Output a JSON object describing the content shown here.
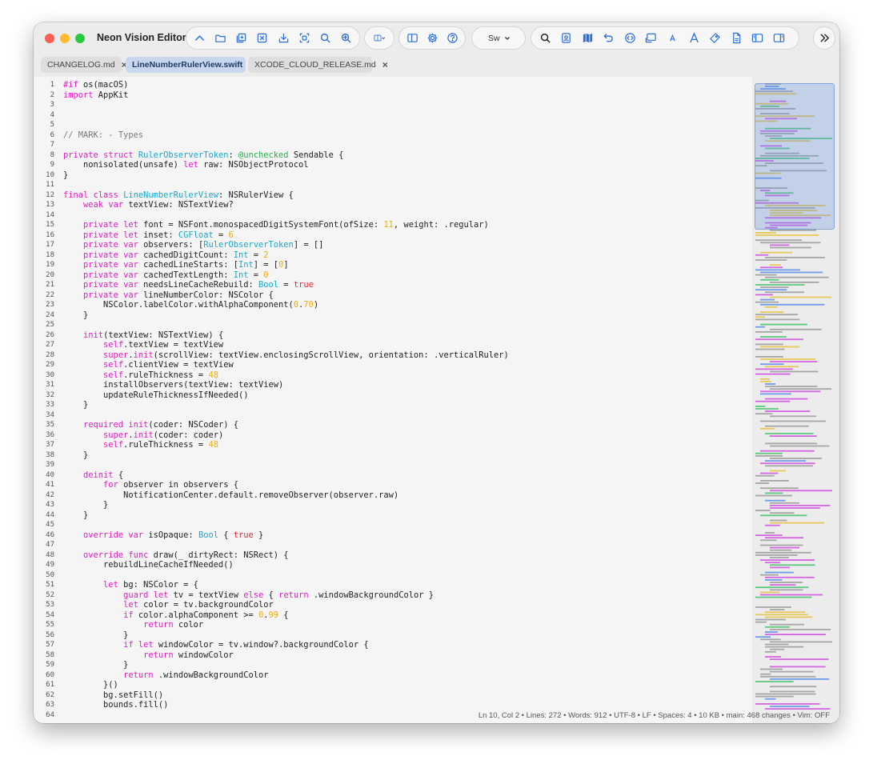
{
  "app": {
    "title": "Neon Vision Editor"
  },
  "toolbar": {
    "group_left": [
      "arrow-up-icon",
      "folder-icon",
      "new-document-icon",
      "close-file-icon",
      "download-icon",
      "scan-icon",
      "search-icon",
      "zoom-in-icon"
    ],
    "group_layout": [
      "split-view-icon",
      "chevron-down-icon"
    ],
    "group_settings": [
      "sidebar-icon",
      "gear-icon",
      "help-icon"
    ],
    "language_selector": "Sw",
    "group_right": [
      "search-icon",
      "preview-icon",
      "map-icon",
      "undo-icon",
      "code-icon",
      "terminal-icon",
      "font-smaller-icon",
      "font-larger-icon",
      "tag-icon",
      "document-icon",
      "left-panel-icon",
      "right-panel-icon"
    ],
    "overflow": "chevron-double-right-icon"
  },
  "tabs": [
    {
      "label": "CHANGELOG.md",
      "active": false
    },
    {
      "label": "LineNumberRulerView.swift",
      "active": true
    },
    {
      "label": "XCODE_CLOUD_RELEASE.md",
      "active": false
    }
  ],
  "editor": {
    "lines": [
      "#if os(macOS)",
      "import AppKit",
      "",
      "",
      "",
      "// MARK: - Types",
      "",
      "private struct RulerObserverToken: @unchecked Sendable {",
      "    nonisolated(unsafe) let raw: NSObjectProtocol",
      "}",
      "",
      "final class LineNumberRulerView: NSRulerView {",
      "    weak var textView: NSTextView?",
      "",
      "    private let font = NSFont.monospacedDigitSystemFont(ofSize: 11, weight: .regular)",
      "    private let inset: CGFloat = 6",
      "    private var observers: [RulerObserverToken] = []",
      "    private var cachedDigitCount: Int = 2",
      "    private var cachedLineStarts: [Int] = [0]",
      "    private var cachedTextLength: Int = 0",
      "    private var needsLineCacheRebuild: Bool = true",
      "    private var lineNumberColor: NSColor {",
      "        NSColor.labelColor.withAlphaComponent(0.70)",
      "    }",
      "",
      "    init(textView: NSTextView) {",
      "        self.textView = textView",
      "        super.init(scrollView: textView.enclosingScrollView, orientation: .verticalRuler)",
      "        self.clientView = textView",
      "        self.ruleThickness = 48",
      "        installObservers(textView: textView)",
      "        updateRuleThicknessIfNeeded()",
      "    }",
      "",
      "    required init(coder: NSCoder) {",
      "        super.init(coder: coder)",
      "        self.ruleThickness = 48",
      "    }",
      "",
      "    deinit {",
      "        for observer in observers {",
      "            NotificationCenter.default.removeObserver(observer.raw)",
      "        }",
      "    }",
      "",
      "    override var isOpaque: Bool { true }",
      "",
      "    override func draw(_ dirtyRect: NSRect) {",
      "        rebuildLineCacheIfNeeded()",
      "",
      "        let bg: NSColor = {",
      "            guard let tv = textView else { return .windowBackgroundColor }",
      "            let color = tv.backgroundColor",
      "            if color.alphaComponent >= 0.99 {",
      "                return color",
      "            }",
      "            if let windowColor = tv.window?.backgroundColor {",
      "                return windowColor",
      "            }",
      "            return .windowBackgroundColor",
      "        }()",
      "        bg.setFill()",
      "        bounds.fill()",
      ""
    ]
  },
  "status": {
    "text": "Ln 10, Col 2 • Lines: 272 • Words: 912 • UTF-8 • LF • Spaces: 4 • 10 KB • main: 468 changes • Vim: OFF"
  },
  "colors": {
    "keyword": "#e51cc8",
    "type": "#16a9cf",
    "number": "#f0ad12",
    "comment": "#7a7a7a",
    "attribute": "#22b34b",
    "boolean": "#e2293b",
    "generic": "#1aa7a0"
  }
}
